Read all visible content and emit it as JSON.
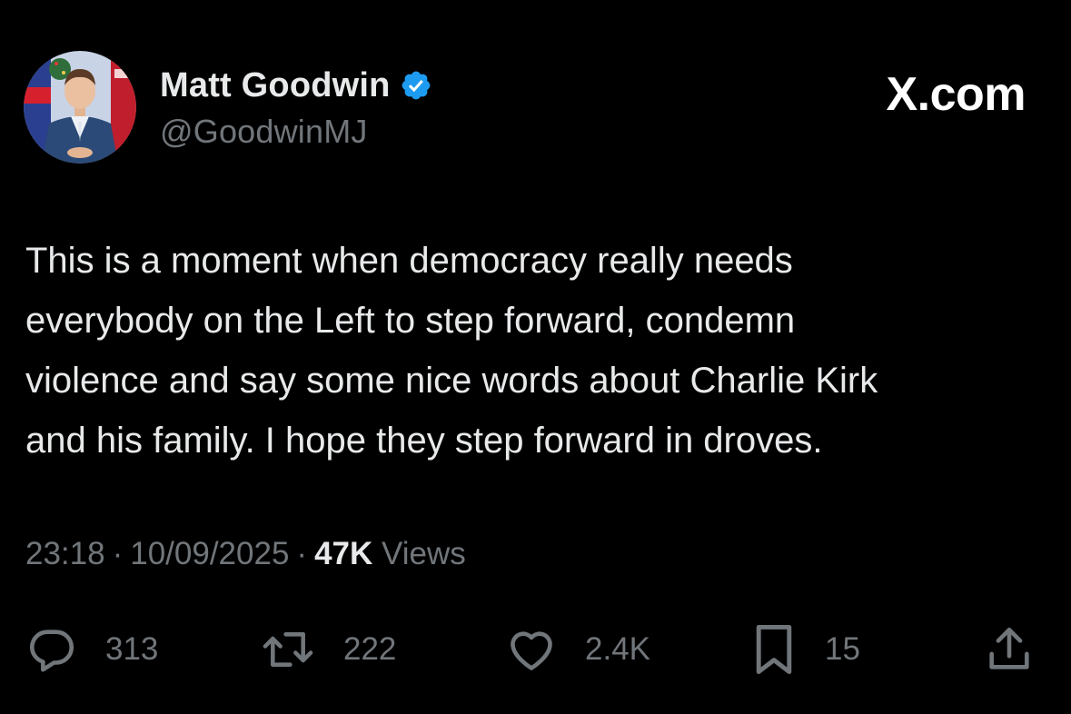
{
  "author": {
    "display_name": "Matt Goodwin",
    "handle": "@GoodwinMJ",
    "verified_icon": "verified-badge-icon",
    "avatar_icon": "avatar-photo"
  },
  "brand": {
    "label": "X.com"
  },
  "tweet": {
    "lines": [
      "This is a moment when democracy really needs",
      "everybody on the Left to step forward, condemn",
      "violence and say some nice words about Charlie Kirk",
      "and his family. I hope they step forward in droves."
    ]
  },
  "meta": {
    "time": "23:18",
    "separator": "·",
    "date": "10/09/2025",
    "views_count": "47K",
    "views_label": "Views"
  },
  "actions": {
    "replies": {
      "count": "313",
      "icon": "reply-icon"
    },
    "reposts": {
      "count": "222",
      "icon": "repost-icon"
    },
    "likes": {
      "count": "2.4K",
      "icon": "heart-icon"
    },
    "bookmarks": {
      "count": "15",
      "icon": "bookmark-icon"
    },
    "share": {
      "icon": "share-icon"
    }
  },
  "colors": {
    "background": "#000000",
    "text_primary": "#e7e9ea",
    "text_secondary": "#71767b",
    "verified_blue": "#1d9bf0"
  }
}
